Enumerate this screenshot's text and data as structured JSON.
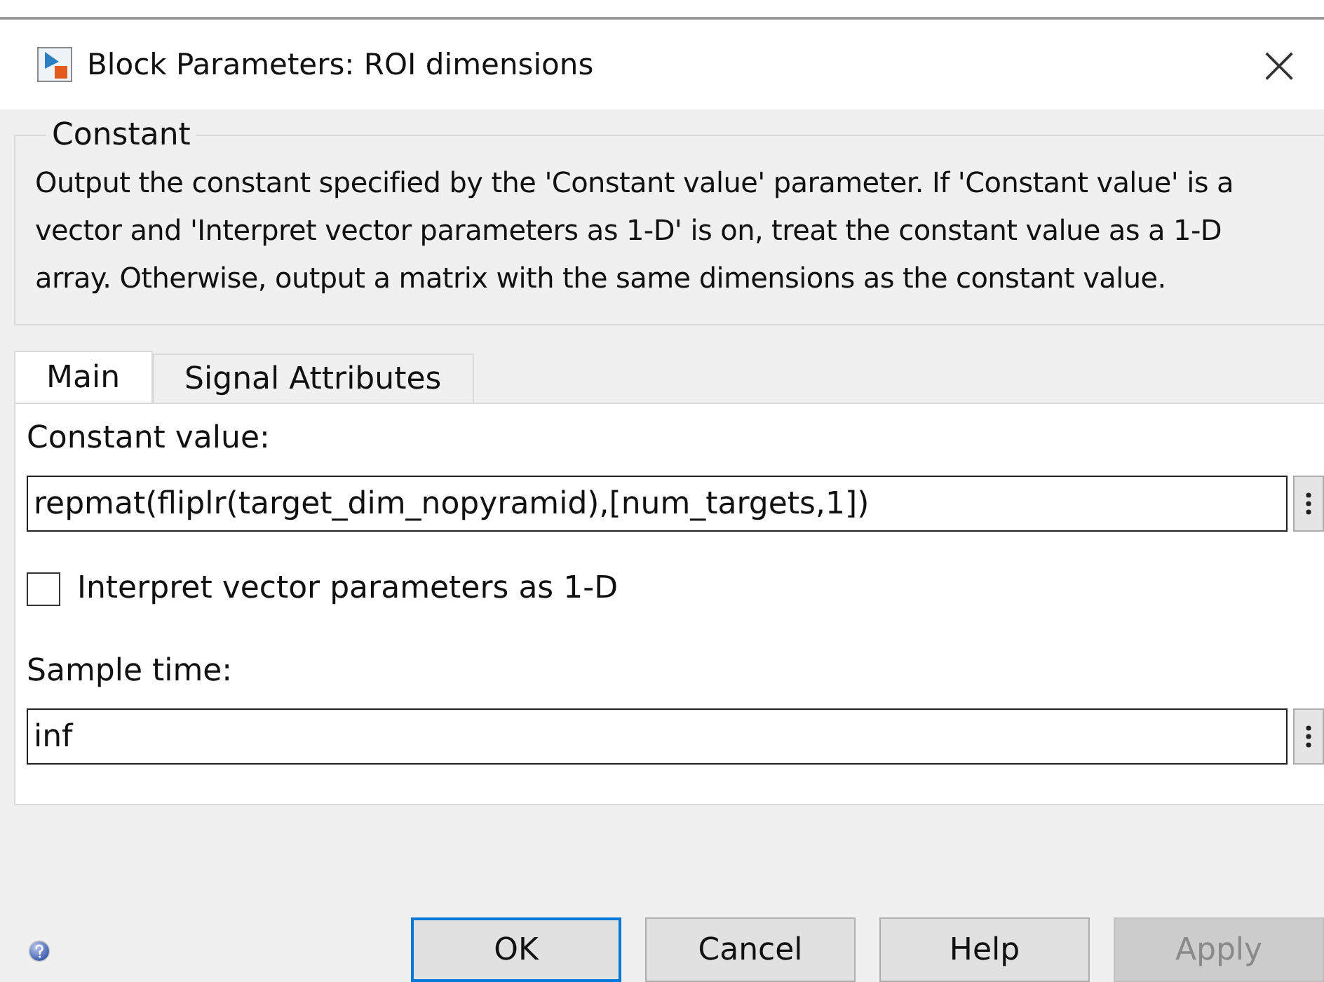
{
  "window": {
    "title": "Block Parameters: ROI dimensions",
    "close": "×"
  },
  "group": {
    "legend": "Constant",
    "description": "Output the constant specified by the 'Constant value' parameter. If 'Constant value' is a vector and 'Interpret vector parameters as 1-D' is on, treat the constant value as a 1-D array. Otherwise, output a matrix with the same dimensions as the constant value."
  },
  "tabs": [
    {
      "label": "Main",
      "selected": true
    },
    {
      "label": "Signal Attributes",
      "selected": false
    }
  ],
  "fields": [
    {
      "kind": "text",
      "label": "Constant value:",
      "value": "repmat(fliplr(target_dim_nopyramid),[num_targets,1])"
    },
    {
      "kind": "checkbox",
      "label": "Interpret vector parameters as 1-D",
      "checked": false
    },
    {
      "kind": "text",
      "label": "Sample time:",
      "value": "inf"
    }
  ],
  "buttons": [
    {
      "label": "OK",
      "focused": true,
      "disabled": false
    },
    {
      "label": "Cancel",
      "focused": false,
      "disabled": false
    },
    {
      "label": "Help",
      "focused": false,
      "disabled": false
    },
    {
      "label": "Apply",
      "focused": false,
      "disabled": true
    }
  ]
}
